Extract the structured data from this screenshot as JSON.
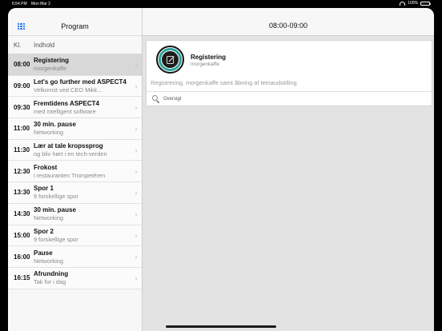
{
  "status_bar": {
    "time": "6:54 PM",
    "date": "Mon Mar 2",
    "battery": "100%"
  },
  "master": {
    "title": "Program",
    "columns": {
      "time": "Kl.",
      "content": "Indhold"
    },
    "items": [
      {
        "time": "08:00",
        "title": "Registering",
        "subtitle": "morgenkaffe",
        "selected": true
      },
      {
        "time": "09:00",
        "title": "Let's go further med ASPECT4",
        "subtitle": "Velkomst ved CEO Mikk...",
        "selected": false
      },
      {
        "time": "09:30",
        "title": "Fremtidens ASPECT4",
        "subtitle": "med intelligent software",
        "selected": false
      },
      {
        "time": "11:00",
        "title": "30 min. pause",
        "subtitle": "Networking",
        "selected": false
      },
      {
        "time": "11:30",
        "title": "Lær at tale kropssprog",
        "subtitle": "og bliv hørt i en tech-verden",
        "selected": false
      },
      {
        "time": "12:30",
        "title": "Frokost",
        "subtitle": "i restauranten Trompetéren",
        "selected": false
      },
      {
        "time": "13:30",
        "title": "Spor 1",
        "subtitle": "9 forskellige spor",
        "selected": false
      },
      {
        "time": "14:30",
        "title": "30 min. pause",
        "subtitle": "Networking",
        "selected": false
      },
      {
        "time": "15:00",
        "title": "Spor 2",
        "subtitle": "9 forskellige spor",
        "selected": false
      },
      {
        "time": "16:00",
        "title": "Pause",
        "subtitle": "Networking",
        "selected": false
      },
      {
        "time": "16:15",
        "title": "Afrundning",
        "subtitle": "Tak for i dag",
        "selected": false
      }
    ]
  },
  "detail": {
    "title": "08:00-09:00",
    "card": {
      "title": "Registering",
      "subtitle": "morgenkaffe",
      "description": "Registrering, morgenkaffe samt åbning af temaudstilling",
      "link_label": "Oversigt"
    }
  },
  "colors": {
    "accent": "#2f7cf6",
    "logo_ring": "#2fa39a",
    "selected_row": "#d8d8d8"
  }
}
